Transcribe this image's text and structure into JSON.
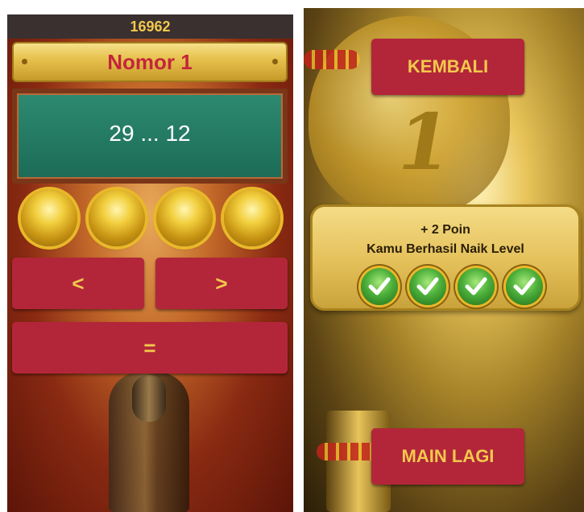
{
  "left_screen": {
    "score": "16962",
    "title": "Nomor 1",
    "question": "29 ... 12",
    "answer_slots": 4,
    "buttons": {
      "less": "<",
      "greater": ">",
      "equal": "="
    }
  },
  "right_screen": {
    "back_button": "KEMBALI",
    "result_points": "+ 2 Poin",
    "result_message": "Kamu Berhasil Naik Level",
    "checkmarks": 4,
    "play_again_button": "MAIN LAGI"
  },
  "colors": {
    "button_red": "#b3263a",
    "button_text_gold": "#f2c94c",
    "board_green": "#1c6b56",
    "title_text_red": "#c3263a"
  }
}
